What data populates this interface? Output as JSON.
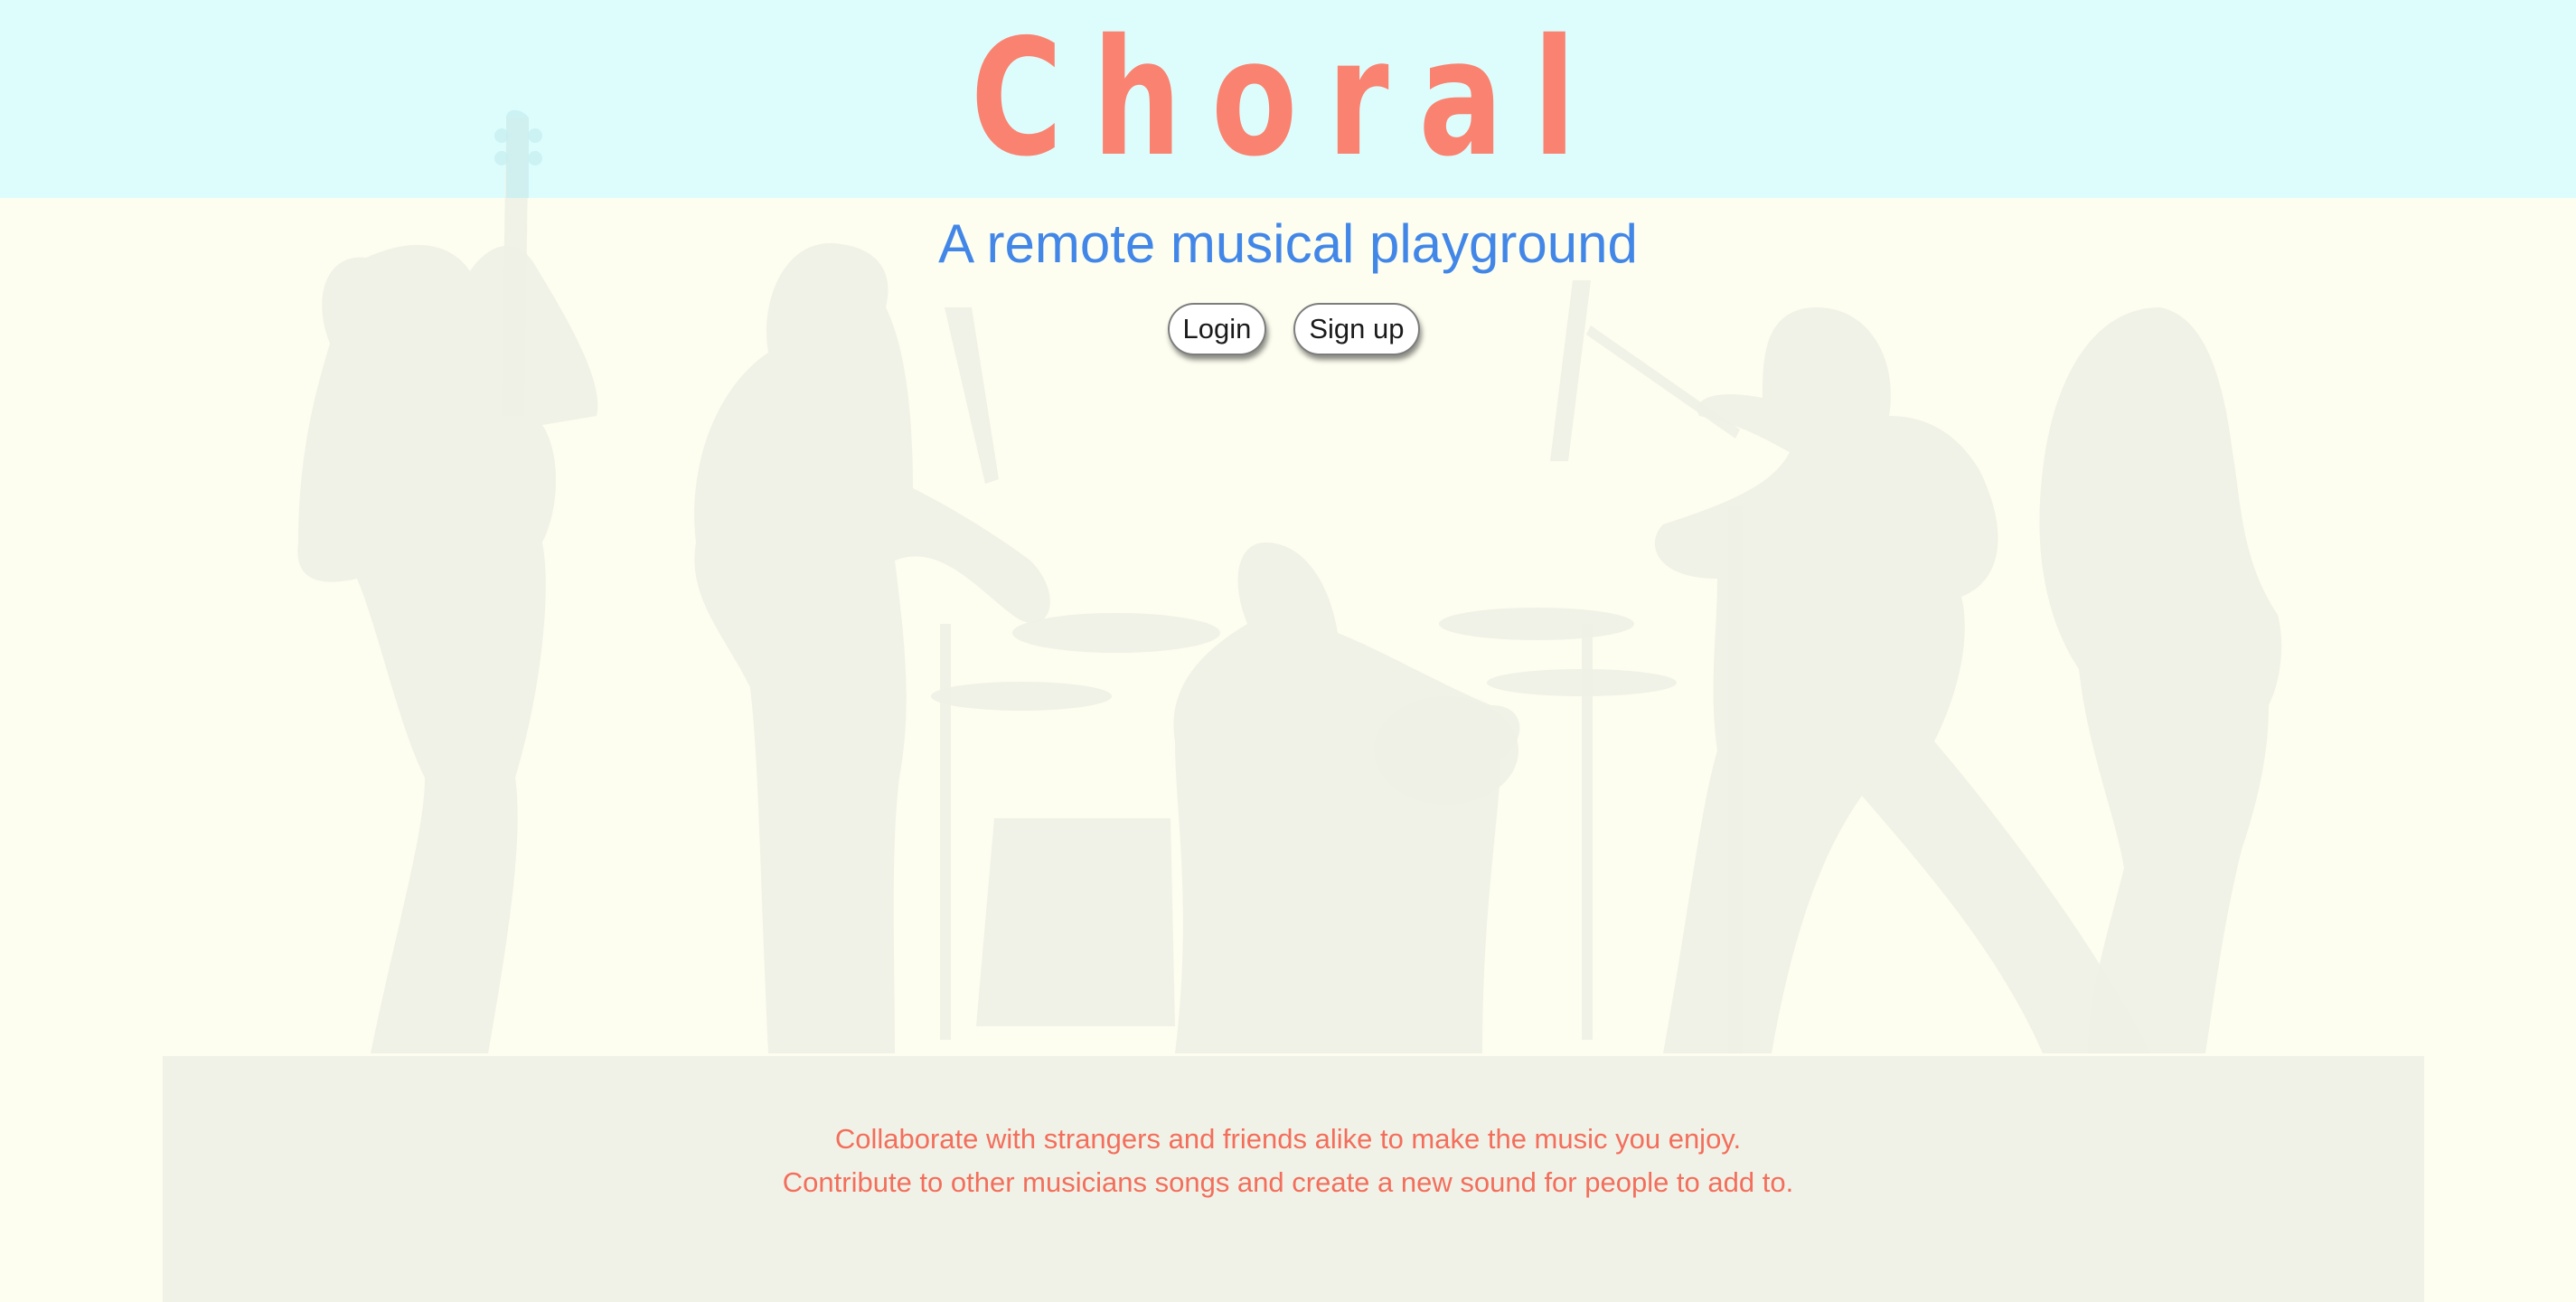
{
  "app": {
    "logo_text": "Choral",
    "tagline": "A remote musical playground"
  },
  "auth": {
    "login_label": "Login",
    "signup_label": "Sign up"
  },
  "description": {
    "line1": "Collaborate with strangers and friends alike to make the music you enjoy.",
    "line2": "Contribute to other musicians songs and create a new sound for people to add to."
  },
  "colors": {
    "header_bg": "#ddfdfd",
    "page_bg": "#fdfef0",
    "logo": "#fa8270",
    "tagline": "#4287e8",
    "description": "#f36e5c",
    "silhouette": "#eff1e6"
  }
}
